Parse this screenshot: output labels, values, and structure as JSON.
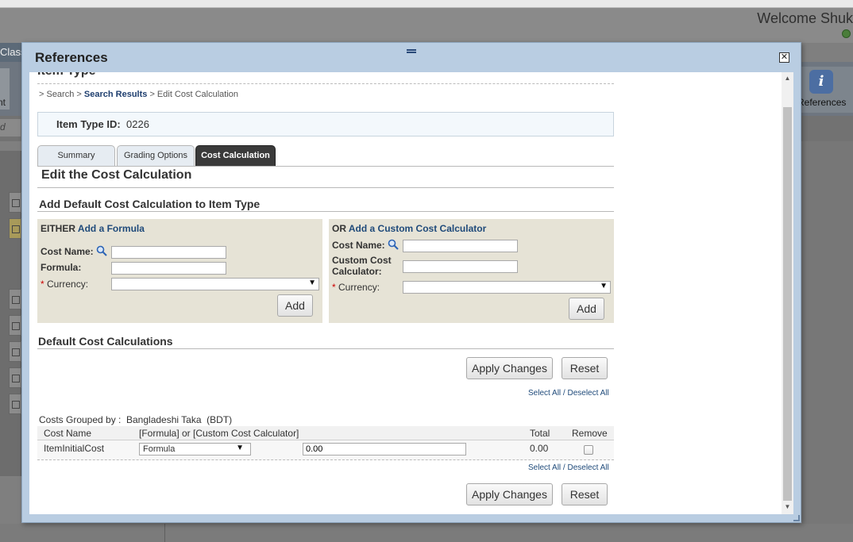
{
  "background": {
    "welcome_text": "Welcome Shuk",
    "class_label": "Class",
    "ribbon_left_label": "nt",
    "references_button_label": "References",
    "search_placeholder": "d"
  },
  "modal": {
    "title": "References",
    "cut_heading": "Item Type",
    "breadcrumb": {
      "prefix": "> Search >",
      "search_results": "Search Results",
      "current": "> Edit Cost Calculation"
    },
    "item_type": {
      "label": "Item Type ID:",
      "value": "0226"
    },
    "tabs": [
      {
        "label": "Summary"
      },
      {
        "label": "Grading Options"
      },
      {
        "label": "Cost Calculation"
      }
    ],
    "page_title": "Edit the Cost Calculation",
    "add_default_title": "Add Default Cost Calculation to Item Type",
    "formula_panel": {
      "either": "EITHER",
      "link": "Add a Formula",
      "cost_name_label": "Cost Name:",
      "cost_name_value": "",
      "formula_label": "Formula:",
      "formula_value": "",
      "required_mark": "*",
      "currency_label": "Currency:",
      "currency_value": "",
      "add_button": "Add"
    },
    "calculator_panel": {
      "or": "OR",
      "link": "Add a Custom Cost Calculator",
      "cost_name_label": "Cost Name:",
      "cost_name_value": "",
      "custom_calc_label_1": "Custom Cost",
      "custom_calc_label_2": "Calculator:",
      "custom_calc_value": "",
      "required_mark": "*",
      "currency_label": "Currency:",
      "currency_value": "",
      "add_button": "Add"
    },
    "default_calcs_title": "Default Cost Calculations",
    "apply_changes": "Apply Changes",
    "reset": "Reset",
    "select_all": "Select All",
    "separator": "/",
    "deselect_all": "Deselect All",
    "grouped_by_label": "Costs Grouped by :",
    "grouped_by_value": "Bangladeshi Taka  (BDT)",
    "table": {
      "columns": [
        "Cost Name",
        "[Formula] or [Custom Cost Calculator]",
        "Total",
        "Remove"
      ],
      "rows": [
        {
          "cost_name": "ItemInitialCost",
          "type": "Formula",
          "formula_value": "0.00",
          "total": "0.00",
          "remove": false
        }
      ]
    }
  },
  "colors": {
    "modal_header": "#b9cde2",
    "panel_bg": "#e6e3d6",
    "link": "#1f4a7a",
    "active_tab": "#3a3a3a",
    "required": "#cc0000"
  }
}
